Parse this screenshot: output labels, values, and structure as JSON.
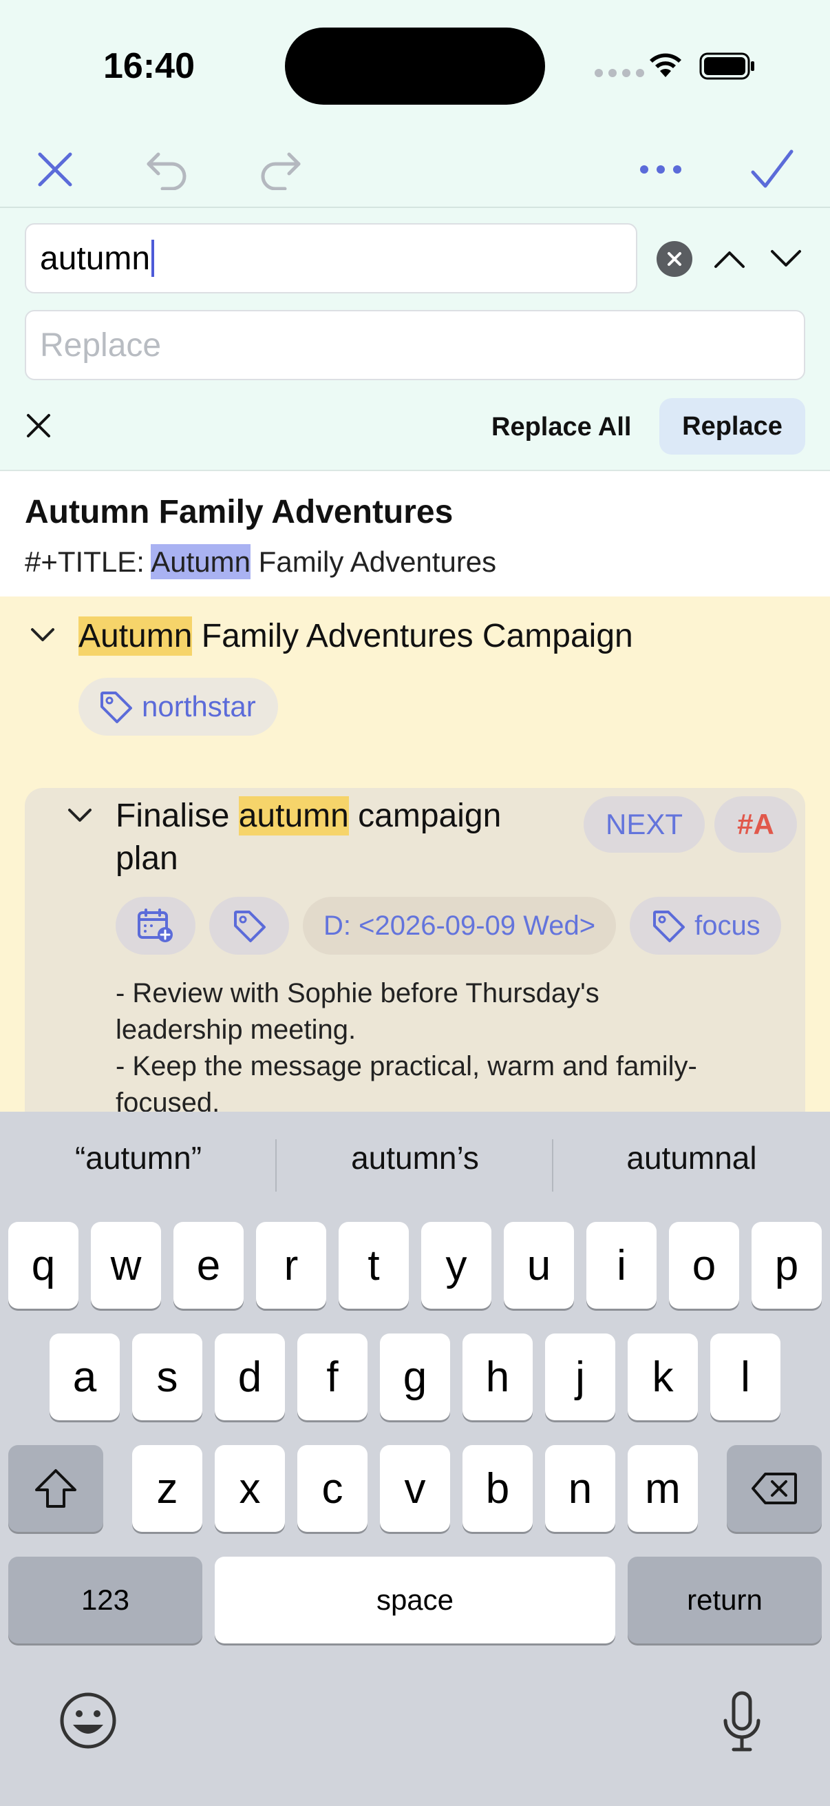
{
  "status": {
    "time": "16:40"
  },
  "find": {
    "query": "autumn",
    "replace_placeholder": "Replace",
    "replace_all_label": "Replace All",
    "replace_label": "Replace"
  },
  "document": {
    "title": "Autumn Family Adventures",
    "title_line_prefix": "#+TITLE: ",
    "title_line_match": "Autumn",
    "title_line_rest": " Family Adventures"
  },
  "campaign": {
    "title_match": "Autumn",
    "title_rest": " Family Adventures Campaign",
    "tag": "northstar"
  },
  "task": {
    "title_before": "Finalise ",
    "title_match": "autumn",
    "title_after": " campaign plan",
    "state": "NEXT",
    "priority": "#A",
    "deadline": "D: <2026-09-09 Wed>",
    "tag": "focus",
    "body": [
      "- Review with Sophie before Thursday's",
      "leadership meeting.",
      "- Keep the message practical, warm and family-",
      "focused."
    ]
  },
  "keyboard": {
    "suggestions": [
      "“autumn”",
      "autumn’s",
      "autumnal"
    ],
    "row1": [
      "q",
      "w",
      "e",
      "r",
      "t",
      "y",
      "u",
      "i",
      "o",
      "p"
    ],
    "row2": [
      "a",
      "s",
      "d",
      "f",
      "g",
      "h",
      "j",
      "k",
      "l"
    ],
    "row3": [
      "z",
      "x",
      "c",
      "v",
      "b",
      "n",
      "m"
    ],
    "numbers_label": "123",
    "space_label": "space",
    "return_label": "return"
  },
  "colors": {
    "accent": "#5b6bd9",
    "match_highlight": "#f6d46a",
    "active_match": "#a9b2f2",
    "priority": "#e1584b"
  }
}
